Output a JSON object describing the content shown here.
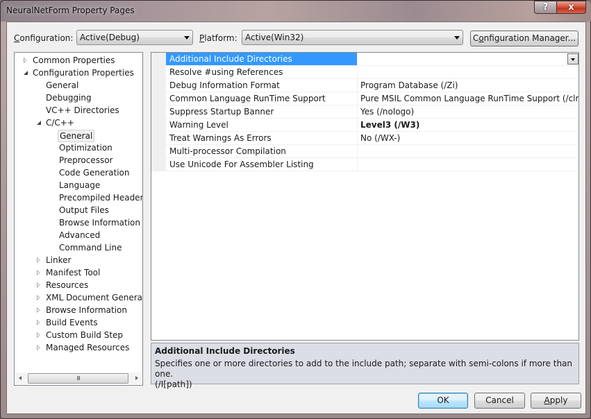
{
  "window": {
    "title": "NeuralNetForm Property Pages",
    "help_icon": "?",
    "close_icon": "x"
  },
  "toolbar": {
    "configuration_label_hotkey": "C",
    "configuration_label_rest": "onfiguration:",
    "configuration_value": "Active(Debug)",
    "platform_label_hotkey": "P",
    "platform_label_rest": "latform:",
    "platform_value": "Active(Win32)",
    "config_manager_pre": "C",
    "config_manager_hotkey": "o",
    "config_manager_rest": "nfiguration Manager..."
  },
  "tree": {
    "items": [
      {
        "label": "Common Properties",
        "level": 0,
        "state": "collapsed"
      },
      {
        "label": "Configuration Properties",
        "level": 0,
        "state": "expanded"
      },
      {
        "label": "General",
        "level": 1,
        "state": "none"
      },
      {
        "label": "Debugging",
        "level": 1,
        "state": "none"
      },
      {
        "label": "VC++ Directories",
        "level": 1,
        "state": "none"
      },
      {
        "label": "C/C++",
        "level": 1,
        "state": "expanded"
      },
      {
        "label": "General",
        "level": 2,
        "state": "none",
        "selected": true
      },
      {
        "label": "Optimization",
        "level": 2,
        "state": "none"
      },
      {
        "label": "Preprocessor",
        "level": 2,
        "state": "none"
      },
      {
        "label": "Code Generation",
        "level": 2,
        "state": "none"
      },
      {
        "label": "Language",
        "level": 2,
        "state": "none"
      },
      {
        "label": "Precompiled Headers",
        "level": 2,
        "state": "none"
      },
      {
        "label": "Output Files",
        "level": 2,
        "state": "none"
      },
      {
        "label": "Browse Information",
        "level": 2,
        "state": "none"
      },
      {
        "label": "Advanced",
        "level": 2,
        "state": "none"
      },
      {
        "label": "Command Line",
        "level": 2,
        "state": "none"
      },
      {
        "label": "Linker",
        "level": 1,
        "state": "collapsed"
      },
      {
        "label": "Manifest Tool",
        "level": 1,
        "state": "collapsed"
      },
      {
        "label": "Resources",
        "level": 1,
        "state": "collapsed"
      },
      {
        "label": "XML Document Generator",
        "level": 1,
        "state": "collapsed"
      },
      {
        "label": "Browse Information",
        "level": 1,
        "state": "collapsed"
      },
      {
        "label": "Build Events",
        "level": 1,
        "state": "collapsed"
      },
      {
        "label": "Custom Build Step",
        "level": 1,
        "state": "collapsed"
      },
      {
        "label": "Managed Resources",
        "level": 1,
        "state": "collapsed"
      }
    ],
    "scroll_thumb_grip": "III"
  },
  "properties": [
    {
      "name": "Additional Include Directories",
      "value": "",
      "selected": true,
      "bold": false
    },
    {
      "name": "Resolve #using References",
      "value": "",
      "bold": false
    },
    {
      "name": "Debug Information Format",
      "value": "Program Database (/Zi)",
      "bold": false
    },
    {
      "name": "Common Language RunTime Support",
      "value": "Pure MSIL Common Language RunTime Support (/clr:pure)",
      "bold": false
    },
    {
      "name": "Suppress Startup Banner",
      "value": "Yes (/nologo)",
      "bold": false
    },
    {
      "name": "Warning Level",
      "value": "Level3 (/W3)",
      "bold": true
    },
    {
      "name": "Treat Warnings As Errors",
      "value": "No (/WX-)",
      "bold": false
    },
    {
      "name": "Multi-processor Compilation",
      "value": "",
      "bold": false
    },
    {
      "name": "Use Unicode For Assembler Listing",
      "value": "",
      "bold": false
    }
  ],
  "description": {
    "title": "Additional Include Directories",
    "text": "Specifies one or more directories to add to the include path; separate with semi-colons if more than one.",
    "switch": "(/I[path])"
  },
  "buttons": {
    "ok": "OK",
    "cancel": "Cancel",
    "apply_hotkey": "A",
    "apply_rest": "pply"
  },
  "colors": {
    "selection": "#3399ff",
    "dialog_bg": "#f0f0f0",
    "desc_bg": "#dbdee6",
    "close_red": "#c3341c"
  }
}
